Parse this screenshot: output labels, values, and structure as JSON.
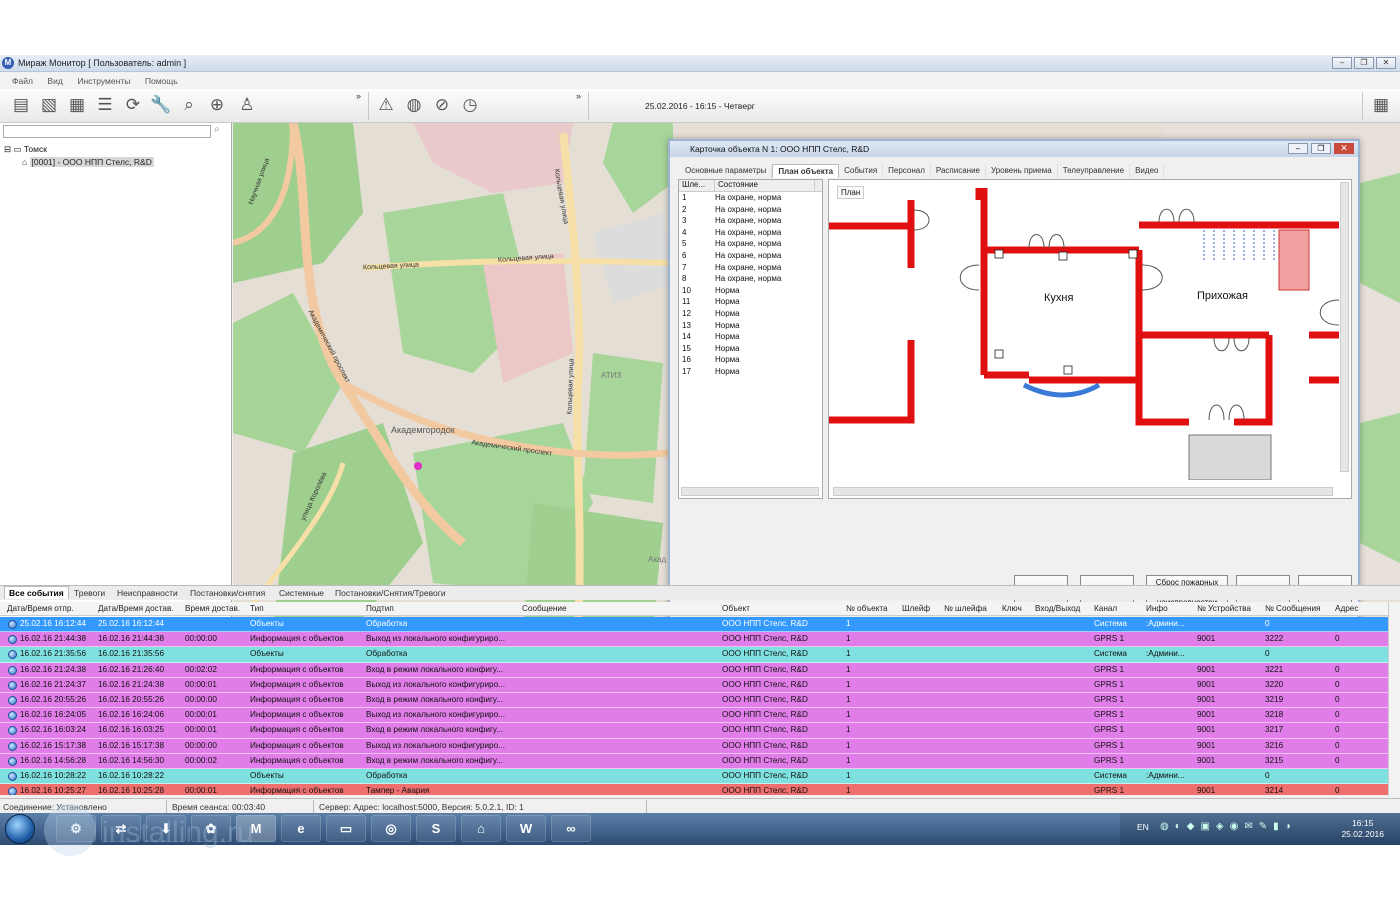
{
  "window": {
    "title": "Мираж Монитор [ Пользователь: admin ]",
    "app_letter": "M"
  },
  "menu": [
    "Файл",
    "Вид",
    "Инструменты",
    "Помощь"
  ],
  "toolbar": {
    "datetime": "25.02.2016 - 16:15 - Четверг",
    "more": "»"
  },
  "sidebar": {
    "root": "Томск",
    "object": "[0001] - ООО НПП Стелс, R&D"
  },
  "map": {
    "labels": [
      "Кольцевая улица",
      "Кольцевая улица",
      "Кольцевая улица",
      "Кольцевая улица",
      "Академический проспект",
      "Академический проспект",
      "Академгородок",
      "АТИЗ",
      "улица Королёва",
      "Научная улица",
      "Акад"
    ]
  },
  "dialog": {
    "title": "Карточка объекта N 1: ООО НПП Стелс, R&D",
    "tabs": [
      "Основные параметры",
      "План объекта",
      "События",
      "Персонал",
      "Расписание",
      "Уровень приема",
      "Телеуправление",
      "Видео"
    ],
    "active_tab": "План объекта",
    "list_headers": [
      "Шле...",
      "Состояние"
    ],
    "list_rows": [
      [
        "1",
        "На охране, норма"
      ],
      [
        "2",
        "На охране, норма"
      ],
      [
        "3",
        "На охране, норма"
      ],
      [
        "4",
        "На охране, норма"
      ],
      [
        "5",
        "На охране, норма"
      ],
      [
        "6",
        "На охране, норма"
      ],
      [
        "7",
        "На охране, норма"
      ],
      [
        "8",
        "На охране, норма"
      ],
      [
        "10",
        "Норма"
      ],
      [
        "11",
        "Норма"
      ],
      [
        "12",
        "Норма"
      ],
      [
        "13",
        "Норма"
      ],
      [
        "14",
        "Норма"
      ],
      [
        "15",
        "Норма"
      ],
      [
        "16",
        "Норма"
      ],
      [
        "17",
        "Норма"
      ]
    ],
    "plan_label": "План",
    "rooms": [
      "Кухня",
      "Прихожая"
    ],
    "buttons": [
      "Обновить",
      "Перевзять",
      "Сброс пожарных тревог и неисправностей",
      "Обработать",
      "Выход"
    ]
  },
  "event_tabs": [
    "Все события",
    "Тревоги",
    "Неисправности",
    "Постановки/снятия",
    "Системные",
    "Постановки/Снятия/Тревоги"
  ],
  "columns": [
    "Дата/Время отпр.",
    "Дата/Время достав.",
    "Время достав.",
    "Тип",
    "Подтип",
    "Сообщение",
    "Объект",
    "№ объекта",
    "Шлейф",
    "№ шлейфа",
    "Ключ",
    "Вход/Выход",
    "Канал",
    "Инфо",
    "№ Устройства",
    "№ Сообщения",
    "Адрес"
  ],
  "events": [
    {
      "c": "sel",
      "d1": "25.02.16 16:12:44",
      "d2": "25.02.16 16:12:44",
      "t": "",
      "type": "Объекты",
      "sub": "Обработка",
      "obj": "ООО НПП Стелс, R&D",
      "n": "1",
      "ch": "Система",
      "info": ":Админи...",
      "dev": "",
      "msg": "0",
      "adr": ""
    },
    {
      "c": "pink",
      "d1": "16.02.16 21:44:38",
      "d2": "16.02.16 21:44:38",
      "t": "00:00:00",
      "type": "Информация с объектов",
      "sub": "Выход из локального конфигуриро...",
      "obj": "ООО НПП Стелс, R&D",
      "n": "1",
      "ch": "GPRS 1",
      "info": "",
      "dev": "9001",
      "msg": "3222",
      "adr": "0"
    },
    {
      "c": "cyan",
      "d1": "16.02.16 21:35:56",
      "d2": "16.02.16 21:35:56",
      "t": "",
      "type": "Объекты",
      "sub": "Обработка",
      "obj": "ООО НПП Стелс, R&D",
      "n": "1",
      "ch": "Система",
      "info": ":Админи...",
      "dev": "",
      "msg": "0",
      "adr": ""
    },
    {
      "c": "pink",
      "d1": "16.02.16 21:24:38",
      "d2": "16.02.16 21:26:40",
      "t": "00:02:02",
      "type": "Информация с объектов",
      "sub": "Вход в режим локального конфигу...",
      "obj": "ООО НПП Стелс, R&D",
      "n": "1",
      "ch": "GPRS 1",
      "info": "",
      "dev": "9001",
      "msg": "3221",
      "adr": "0"
    },
    {
      "c": "pink",
      "d1": "16.02.16 21:24:37",
      "d2": "16.02.16 21:24:38",
      "t": "00:00:01",
      "type": "Информация с объектов",
      "sub": "Выход из локального конфигуриро...",
      "obj": "ООО НПП Стелс, R&D",
      "n": "1",
      "ch": "GPRS 1",
      "info": "",
      "dev": "9001",
      "msg": "3220",
      "adr": "0"
    },
    {
      "c": "pink",
      "d1": "16.02.16 20:55:26",
      "d2": "16.02.16 20:55:26",
      "t": "00:00:00",
      "type": "Информация с объектов",
      "sub": "Вход в режим локального конфигу...",
      "obj": "ООО НПП Стелс, R&D",
      "n": "1",
      "ch": "GPRS 1",
      "info": "",
      "dev": "9001",
      "msg": "3219",
      "adr": "0"
    },
    {
      "c": "pink",
      "d1": "16.02.16 16:24:05",
      "d2": "16.02.16 16:24:06",
      "t": "00:00:01",
      "type": "Информация с объектов",
      "sub": "Выход из локального конфигуриро...",
      "obj": "ООО НПП Стелс, R&D",
      "n": "1",
      "ch": "GPRS 1",
      "info": "",
      "dev": "9001",
      "msg": "3218",
      "adr": "0"
    },
    {
      "c": "pink",
      "d1": "16.02.16 16:03:24",
      "d2": "16.02.16 16:03:25",
      "t": "00:00:01",
      "type": "Информация с объектов",
      "sub": "Вход в режим локального конфигу...",
      "obj": "ООО НПП Стелс, R&D",
      "n": "1",
      "ch": "GPRS 1",
      "info": "",
      "dev": "9001",
      "msg": "3217",
      "adr": "0"
    },
    {
      "c": "pink",
      "d1": "16.02.16 15:17:38",
      "d2": "16.02.16 15:17:38",
      "t": "00:00:00",
      "type": "Информация с объектов",
      "sub": "Выход из локального конфигуриро...",
      "obj": "ООО НПП Стелс, R&D",
      "n": "1",
      "ch": "GPRS 1",
      "info": "",
      "dev": "9001",
      "msg": "3216",
      "adr": "0"
    },
    {
      "c": "pink",
      "d1": "16.02.16 14:56:28",
      "d2": "16.02.16 14:56:30",
      "t": "00:00:02",
      "type": "Информация с объектов",
      "sub": "Вход в режим локального конфигу...",
      "obj": "ООО НПП Стелс, R&D",
      "n": "1",
      "ch": "GPRS 1",
      "info": "",
      "dev": "9001",
      "msg": "3215",
      "adr": "0"
    },
    {
      "c": "cyan",
      "d1": "16.02.16 10:28:22",
      "d2": "16.02.16 10:28:22",
      "t": "",
      "type": "Объекты",
      "sub": "Обработка",
      "obj": "ООО НПП Стелс, R&D",
      "n": "1",
      "ch": "Система",
      "info": ":Админи...",
      "dev": "",
      "msg": "0",
      "adr": ""
    },
    {
      "c": "red",
      "d1": "16.02.16 10:25:27",
      "d2": "16.02.16 10:25:28",
      "t": "00:00:01",
      "type": "Информация с объектов",
      "sub": "Тампер - Авария",
      "obj": "ООО НПП Стелс, R&D",
      "n": "1",
      "ch": "GPRS 1",
      "info": "",
      "dev": "9001",
      "msg": "3214",
      "adr": "0"
    }
  ],
  "row_colors": {
    "sel": "#3399ff",
    "pink": "#e07de8",
    "cyan": "#7fe0e0",
    "red": "#ef6f6f"
  },
  "status": {
    "conn": "Соединение: Установлено",
    "session": "Время сеанса: 00:03:40",
    "server": "Сервер: Адрес: localhost:5000, Версия: 5.0.2.1, ID: 1"
  },
  "taskbar": {
    "lang": "EN",
    "time": "16:15",
    "date": "25.02.2016"
  },
  "watermark": "installing.ru"
}
